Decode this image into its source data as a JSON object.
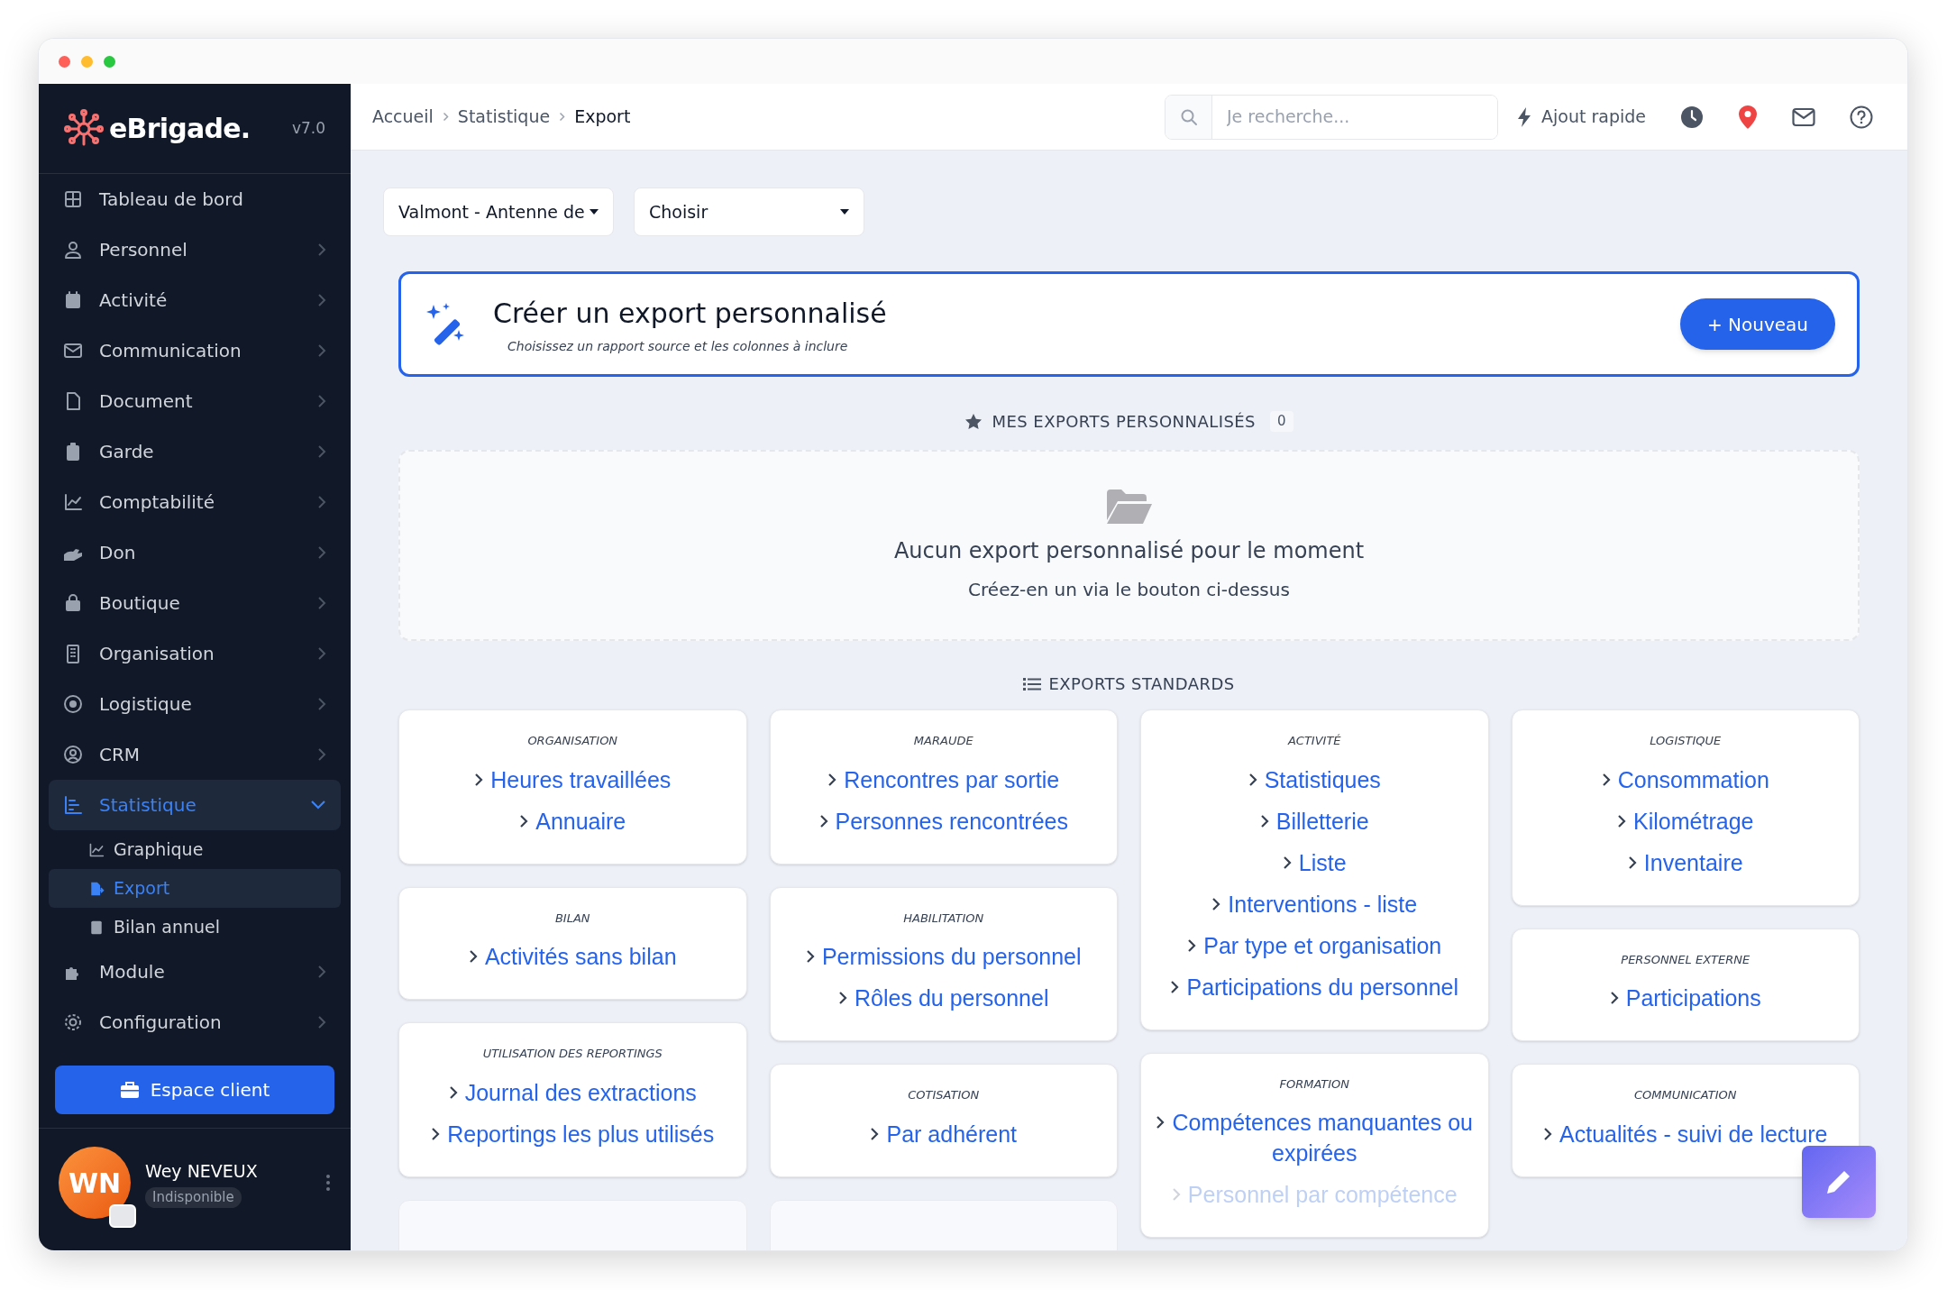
{
  "app": {
    "logo": "eBrigade.",
    "version": "v7.0"
  },
  "sidebar": {
    "items": [
      {
        "label": "Tableau de bord",
        "expandable": false,
        "expanded": false,
        "selected": false
      },
      {
        "label": "Personnel",
        "expandable": true,
        "expanded": false,
        "selected": false
      },
      {
        "label": "Activité",
        "expandable": true,
        "expanded": false,
        "selected": false
      },
      {
        "label": "Communication",
        "expandable": true,
        "expanded": false,
        "selected": false
      },
      {
        "label": "Document",
        "expandable": true,
        "expanded": false,
        "selected": false
      },
      {
        "label": "Garde",
        "expandable": true,
        "expanded": false,
        "selected": false
      },
      {
        "label": "Comptabilité",
        "expandable": true,
        "expanded": false,
        "selected": false
      },
      {
        "label": "Don",
        "expandable": true,
        "expanded": false,
        "selected": false
      },
      {
        "label": "Boutique",
        "expandable": true,
        "expanded": false,
        "selected": false
      },
      {
        "label": "Organisation",
        "expandable": true,
        "expanded": false,
        "selected": false
      },
      {
        "label": "Logistique",
        "expandable": true,
        "expanded": false,
        "selected": false
      },
      {
        "label": "CRM",
        "expandable": true,
        "expanded": false,
        "selected": false
      },
      {
        "label": "Statistique",
        "expandable": true,
        "expanded": true,
        "selected": true,
        "children": [
          {
            "label": "Graphique",
            "selected": false
          },
          {
            "label": "Export",
            "selected": true
          },
          {
            "label": "Bilan annuel",
            "selected": false
          }
        ]
      },
      {
        "label": "Module",
        "expandable": true,
        "expanded": false,
        "selected": false
      },
      {
        "label": "Configuration",
        "expandable": true,
        "expanded": false,
        "selected": false
      }
    ],
    "client_button": "Espace client",
    "user": {
      "initials": "WN",
      "name": "Wey NEVEUX",
      "status": "Indisponible"
    }
  },
  "breadcrumb": [
    "Accueil",
    "Statistique",
    "Export"
  ],
  "search": {
    "placeholder": "Je recherche..."
  },
  "quick_add": "Ajout rapide",
  "filters": [
    {
      "value": "Valmont - Antenne de"
    },
    {
      "value": "Choisir"
    }
  ],
  "create_card": {
    "title": "Créer un export personnalisé",
    "subtitle": "Choisissez un rapport source et les colonnes à inclure",
    "button": "+ Nouveau"
  },
  "my_exports": {
    "title": "MES EXPORTS PERSONNALISÉS",
    "count": "0",
    "empty_title": "Aucun export personnalisé pour le moment",
    "empty_text": "Créez-en un via le bouton ci-dessus"
  },
  "standard_exports": {
    "title": "EXPORTS STANDARDS",
    "columns": [
      [
        {
          "kind": "links",
          "category": "ORGANISATION",
          "links": [
            "Heures travaillées",
            "Annuaire"
          ]
        },
        {
          "kind": "links",
          "category": "BILAN",
          "links": [
            "Activités sans bilan"
          ]
        },
        {
          "kind": "links",
          "category": "UTILISATION DES REPORTINGS",
          "links": [
            "Journal des extractions",
            "Reportings les plus utilisés"
          ]
        },
        {
          "kind": "partial"
        }
      ],
      [
        {
          "kind": "links",
          "category": "MARAUDE",
          "links": [
            "Rencontres par sortie",
            "Personnes rencontrées"
          ]
        },
        {
          "kind": "links",
          "category": "HABILITATION",
          "links": [
            "Permissions du personnel",
            "Rôles du personnel"
          ]
        },
        {
          "kind": "links",
          "category": "COTISATION",
          "links": [
            "Par adhérent"
          ]
        },
        {
          "kind": "partial"
        }
      ],
      [
        {
          "kind": "links",
          "category": "ACTIVITÉ",
          "links": [
            "Statistiques",
            "Billetterie",
            "Liste",
            "Interventions - liste",
            "Par type et organisation",
            "Participations du personnel"
          ]
        },
        {
          "kind": "links",
          "category": "FORMATION",
          "links": [
            "Compétences manquantes ou expirées",
            "Personnel par compétence"
          ]
        }
      ],
      [
        {
          "kind": "links",
          "category": "LOGISTIQUE",
          "links": [
            "Consommation",
            "Kilométrage",
            "Inventaire"
          ]
        },
        {
          "kind": "links",
          "category": "PERSONNEL EXTERNE",
          "links": [
            "Participations"
          ]
        },
        {
          "kind": "links",
          "category": "COMMUNICATION",
          "links": [
            "Actualités - suivi de lecture"
          ]
        }
      ]
    ]
  }
}
